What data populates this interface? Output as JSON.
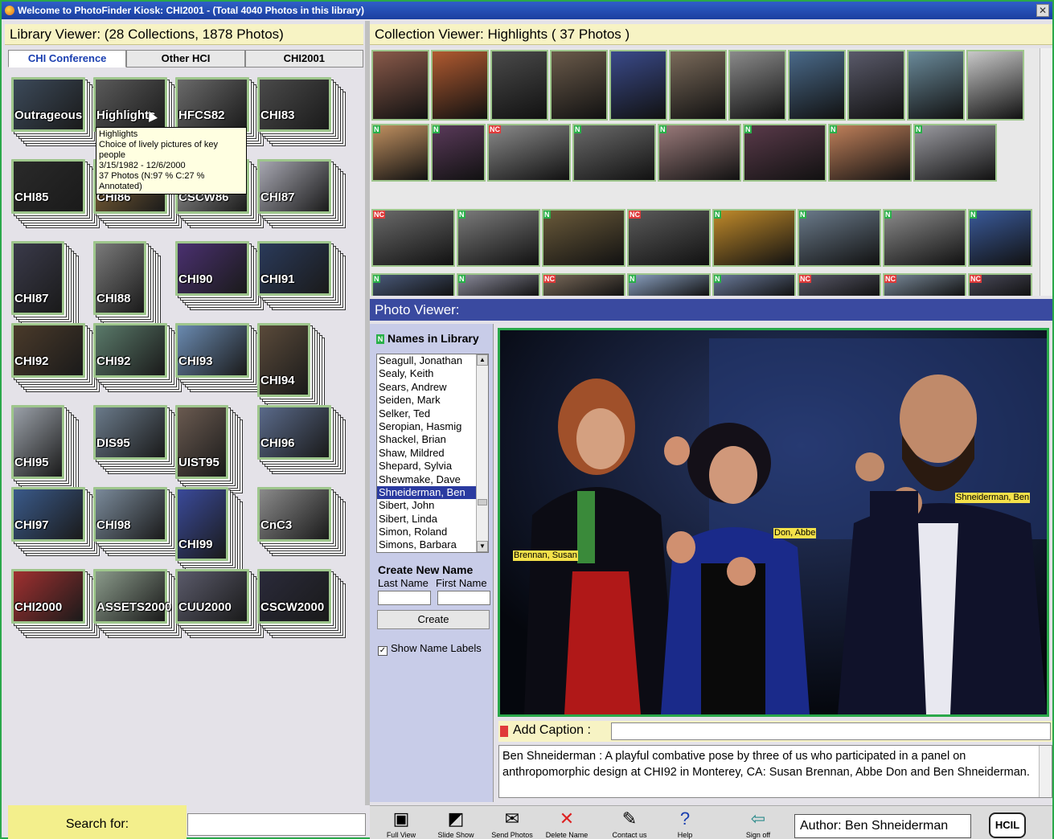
{
  "window": {
    "title": "Welcome to PhotoFinder Kiosk: CHI2001 - (Total 4040 Photos in this library)"
  },
  "library": {
    "header": "Library Viewer: (28 Collections, 1878 Photos)",
    "tabs": [
      "CHI Conference",
      "Other HCI",
      "CHI2001"
    ],
    "collections": [
      {
        "label": "Outrageous",
        "color": "#3c4a5a"
      },
      {
        "label": "Highlights",
        "color": "#5a5a5a"
      },
      {
        "label": "HFCS82",
        "color": "#6a6a6a"
      },
      {
        "label": "CHI83",
        "color": "#4a4a4a"
      },
      {
        "label": "CHI85",
        "color": "#2a2a2a"
      },
      {
        "label": "CHI86",
        "color": "#8a6a3a"
      },
      {
        "label": "CSCW86",
        "color": "#9a9a9a"
      },
      {
        "label": "CHI87",
        "color": "#a6a6b0"
      },
      {
        "label": "CHI87",
        "color": "#3a3a4a"
      },
      {
        "label": "CHI88",
        "color": "#7a7a7a"
      },
      {
        "label": "CHI90",
        "color": "#4a3070"
      },
      {
        "label": "CHI91",
        "color": "#2a3a5a"
      },
      {
        "label": "CHI92",
        "color": "#4a3a2a"
      },
      {
        "label": "CHI92",
        "color": "#5a7a6a"
      },
      {
        "label": "CHI93",
        "color": "#6a8ab0"
      },
      {
        "label": "CHI94",
        "color": "#5a4a3a"
      },
      {
        "label": "CHI95",
        "color": "#9aa0a8"
      },
      {
        "label": "DIS95",
        "color": "#6a7a8a"
      },
      {
        "label": "UIST95",
        "color": "#6a5a50"
      },
      {
        "label": "CHI96",
        "color": "#5a6a8a"
      },
      {
        "label": "CHI97",
        "color": "#3a5a8a"
      },
      {
        "label": "CHI98",
        "color": "#7a8a9a"
      },
      {
        "label": "CHI99",
        "color": "#3a4a9a"
      },
      {
        "label": "CnC3",
        "color": "#8a8a8a"
      },
      {
        "label": "CHI2000",
        "color": "#a03030"
      },
      {
        "label": "ASSETS2000",
        "color": "#8a9a8a"
      },
      {
        "label": "CUU2000",
        "color": "#5a5a6a"
      },
      {
        "label": "CSCW2000",
        "color": "#2a2a3a"
      }
    ],
    "tooltip": {
      "title": "Highlights",
      "desc": "Choice of lively pictures of key people",
      "dates": "3/15/1982 - 12/6/2000",
      "stats": "37 Photos (N:97 % C:27 % Annotated)"
    }
  },
  "collection_viewer": {
    "header": "Collection Viewer: Highlights (  37 Photos )",
    "row1_colors": [
      "#8a5a4a",
      "#b05a30",
      "#4a4a4a",
      "#6a5a4a",
      "#3a4a8a",
      "#7a6a5a",
      "#8a8a8a",
      "#4a6a8a",
      "#5a5a6a",
      "#6a8a9a",
      "#c8c8c8"
    ],
    "row2_colors": [
      "#c09060",
      "#5a3a5a",
      "#8a8a8a",
      "#6a6a6a",
      "#9a7a7a",
      "#5a3a4a",
      "#c0805a",
      "#9a9aa0"
    ],
    "row3_colors": [
      "#6a6a6a",
      "#7a7a7a",
      "#6a5a3a",
      "#5a5a5a",
      "#c08a2a",
      "#6a7a8a",
      "#8a8a8a",
      "#3a5a9a"
    ],
    "row4_colors": [
      "#4a5a7a",
      "#8a8a9a",
      "#7a6a5a",
      "#8aa0c0",
      "#6a7a9a",
      "#5a5a6a",
      "#7a8a9a",
      "#4a4a5a"
    ]
  },
  "photo_viewer": {
    "header": "Photo Viewer:",
    "names_title": "Names in Library",
    "names": [
      "Seagull, Jonathan",
      "Sealy, Keith",
      "Sears, Andrew",
      "Seiden, Mark",
      "Selker, Ted",
      "Seropian, Hasmig",
      "Shackel, Brian",
      "Shaw, Mildred",
      "Shepard, Sylvia",
      "Shewmake, Dave",
      "Shneiderman, Ben",
      "Sibert, John",
      "Sibert, Linda",
      "Simon, Roland",
      "Simons, Barbara"
    ],
    "selected_name": "Shneiderman, Ben",
    "create_title": "Create New Name",
    "last_name_label": "Last Name",
    "first_name_label": "First Name",
    "create_button": "Create",
    "show_labels": "Show Name Labels",
    "show_labels_checked": true,
    "photo_labels": {
      "brennan": "Brennan, Susan",
      "don": "Don, Abbe",
      "shneiderman": "Shneiderman, Ben"
    },
    "caption_label": "Add Caption :",
    "caption_text": "Ben Shneiderman : A playful combative pose by three of us who participated in a panel on anthropomorphic design at CHI92 in Monterey, CA: Susan Brennan, Abbe Don and Ben Shneiderman."
  },
  "bottom": {
    "search_label": "Search for:",
    "toolbar": [
      {
        "label": "Full View",
        "icon": "full-view-icon"
      },
      {
        "label": "Slide Show",
        "icon": "slide-show-icon"
      },
      {
        "label": "Send Photos",
        "icon": "envelope-icon"
      },
      {
        "label": "Delete Name",
        "icon": "delete-x-icon"
      },
      {
        "label": "Contact us",
        "icon": "contact-icon"
      },
      {
        "label": "Help",
        "icon": "help-icon"
      },
      {
        "label": "Sign off",
        "icon": "sign-off-icon"
      }
    ],
    "author": "Author: Ben Shneiderman",
    "logo": "HCIL"
  }
}
